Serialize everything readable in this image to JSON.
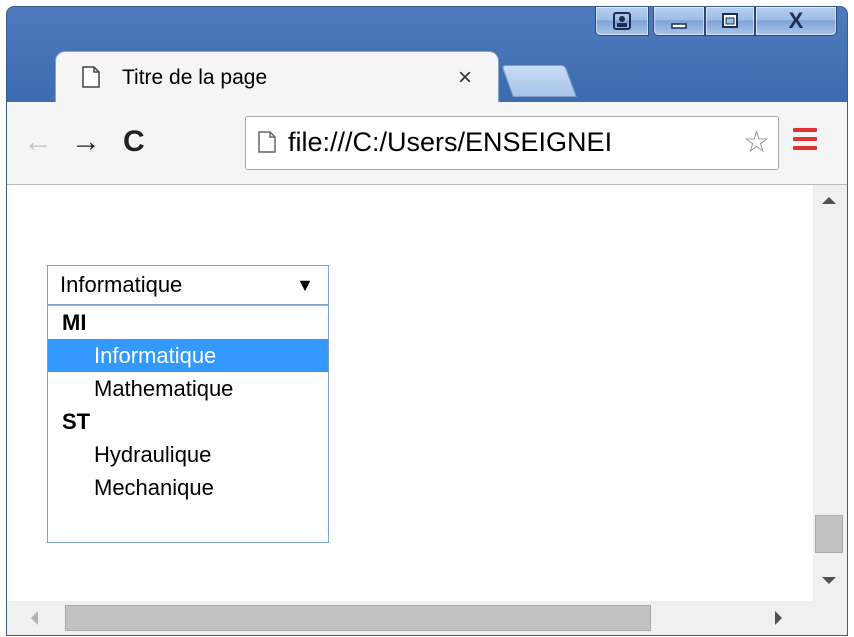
{
  "window": {
    "caption_buttons": [
      "user-icon",
      "minimize-icon",
      "maximize-icon",
      "close-icon"
    ],
    "close_glyph": "X"
  },
  "tab": {
    "title": "Titre de la page",
    "icon": "page-icon",
    "close_glyph": "×"
  },
  "toolbar": {
    "back_glyph": "←",
    "forward_glyph": "→",
    "reload_glyph": "C",
    "url": "file:///C:/Users/ENSEIGNEI",
    "star_glyph": "☆",
    "menu_icon": "hamburger-menu-icon",
    "menu_color": "#e03030"
  },
  "select": {
    "value": "Informatique",
    "arrow_glyph": "▼",
    "groups": [
      {
        "label": "MI",
        "options": [
          "Informatique",
          "Mathematique"
        ]
      },
      {
        "label": "ST",
        "options": [
          "Hydraulique",
          "Mechanique"
        ]
      }
    ],
    "highlight_color": "#3399ff"
  }
}
